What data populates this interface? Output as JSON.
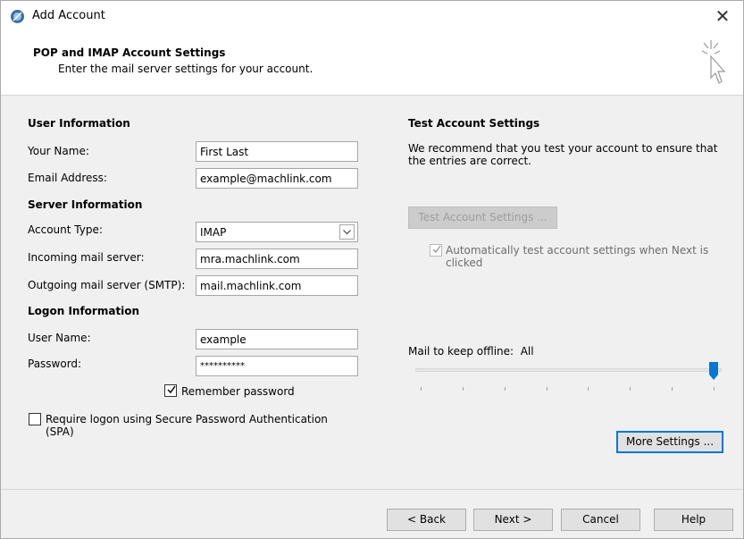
{
  "window": {
    "title": "Add Account",
    "close_glyph": "✕"
  },
  "header": {
    "title": "POP and IMAP Account Settings",
    "subtitle": "Enter the mail server settings for your account."
  },
  "user_information": {
    "heading": "User Information",
    "your_name_label": "Your Name:",
    "your_name_value": "First Last",
    "email_label": "Email Address:",
    "email_value": "example@machlink.com"
  },
  "server_information": {
    "heading": "Server Information",
    "account_type_label": "Account Type:",
    "account_type_value": "IMAP",
    "incoming_label": "Incoming mail server:",
    "incoming_value": "mra.machlink.com",
    "outgoing_label": "Outgoing mail server (SMTP):",
    "outgoing_value": "mail.machlink.com"
  },
  "logon_information": {
    "heading": "Logon Information",
    "user_name_label": "User Name:",
    "user_name_value": "example",
    "password_label": "Password:",
    "password_value": "**********",
    "remember_label": "Remember password",
    "remember_checked": true,
    "spa_label": "Require logon using Secure Password Authentication (SPA)",
    "spa_checked": false
  },
  "test_settings": {
    "heading": "Test Account Settings",
    "description": "We recommend that you test your account to ensure that the entries are correct.",
    "test_button": "Test Account Settings ...",
    "auto_test_label": "Automatically test account settings when Next is clicked",
    "auto_test_checked": true
  },
  "offline": {
    "label": "Mail to keep offline:",
    "value": "All",
    "level_fraction": 1.0
  },
  "buttons": {
    "more_settings": "More Settings ...",
    "back": "< Back",
    "next": "Next >",
    "cancel": "Cancel",
    "help": "Help"
  },
  "colors": {
    "accent": "#0078d7",
    "dialog_bg": "#f0f0f0"
  }
}
